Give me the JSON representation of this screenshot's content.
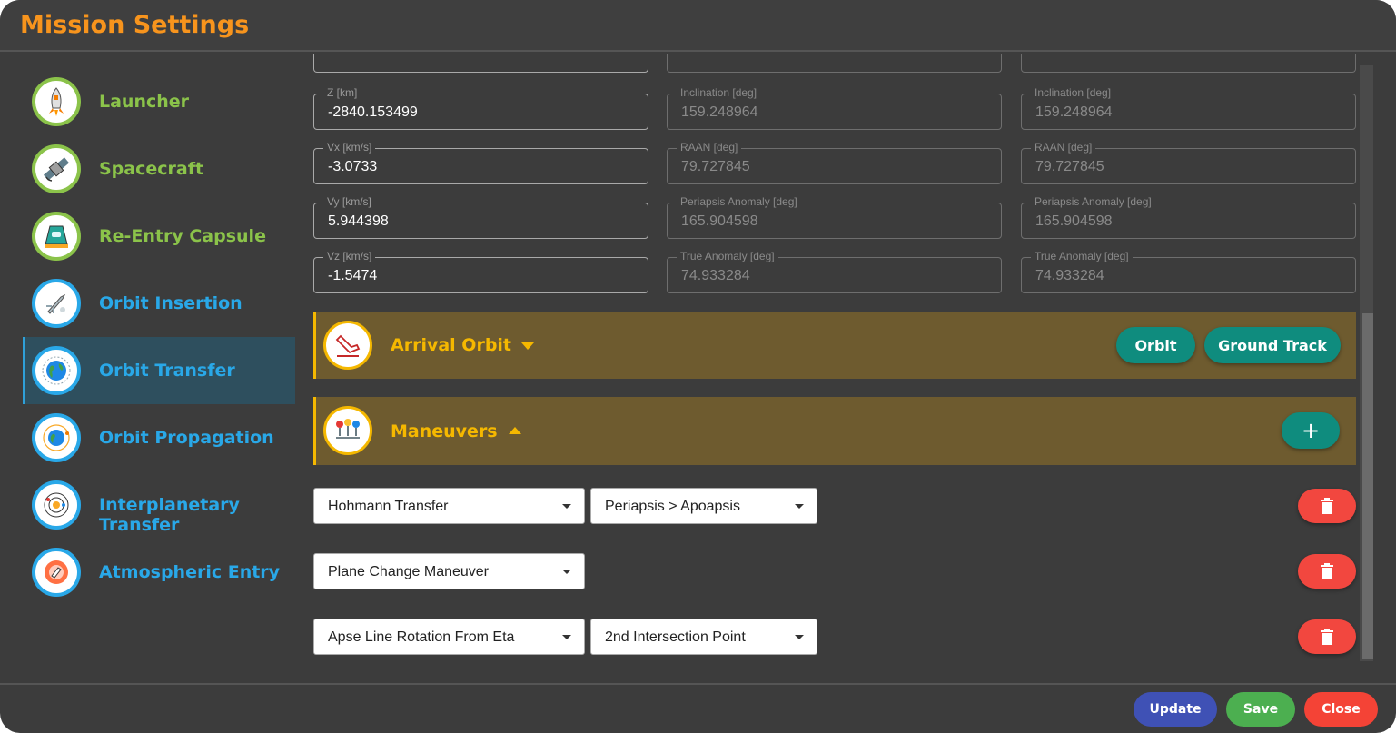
{
  "window": {
    "title": "Mission Settings"
  },
  "sidebar": {
    "items": [
      {
        "label": "Launcher",
        "icon": "rocket-icon",
        "color": "#8bc34a"
      },
      {
        "label": "Spacecraft",
        "icon": "satellite-icon",
        "color": "#8bc34a"
      },
      {
        "label": "Re-Entry Capsule",
        "icon": "capsule-icon",
        "color": "#8bc34a"
      },
      {
        "label": "Orbit Insertion",
        "icon": "orbit-insertion-icon",
        "color": "#29a8e8"
      },
      {
        "label": "Orbit Transfer",
        "icon": "earth-orbit-icon",
        "color": "#29a8e8",
        "active": true
      },
      {
        "label": "Orbit Propagation",
        "icon": "orbit-propagation-icon",
        "color": "#29a8e8"
      },
      {
        "label": "Interplanetary Transfer",
        "icon": "solar-system-icon",
        "color": "#29a8e8"
      },
      {
        "label": "Atmospheric Entry",
        "icon": "atmospheric-entry-icon",
        "color": "#29a8e8"
      }
    ]
  },
  "state_fields": [
    {
      "label": "Z [km]",
      "value": "-2840.153499"
    },
    {
      "label": "Vx [km/s]",
      "value": "-3.0733"
    },
    {
      "label": "Vy [km/s]",
      "value": "5.944398"
    },
    {
      "label": "Vz [km/s]",
      "value": "-1.5474"
    }
  ],
  "elements_a": [
    {
      "label": "Inclination [deg]",
      "value": "159.248964"
    },
    {
      "label": "RAAN [deg]",
      "value": "79.727845"
    },
    {
      "label": "Periapsis Anomaly [deg]",
      "value": "165.904598"
    },
    {
      "label": "True Anomaly [deg]",
      "value": "74.933284"
    }
  ],
  "elements_b": [
    {
      "label": "Inclination [deg]",
      "value": "159.248964"
    },
    {
      "label": "RAAN [deg]",
      "value": "79.727845"
    },
    {
      "label": "Periapsis Anomaly [deg]",
      "value": "165.904598"
    },
    {
      "label": "True Anomaly [deg]",
      "value": "74.933284"
    }
  ],
  "arrival": {
    "title": "Arrival Orbit",
    "icon": "arrival-icon",
    "orbit_label": "Orbit",
    "ground_track_label": "Ground Track"
  },
  "maneuvers": {
    "title": "Maneuvers",
    "icon": "maneuvers-icon",
    "add_label": "+",
    "rows": [
      {
        "type": "Hohmann Transfer",
        "option": "Periapsis > Apoapsis"
      },
      {
        "type": "Plane Change Maneuver"
      },
      {
        "type": "Apse Line Rotation From Eta",
        "option": "2nd Intersection Point"
      }
    ]
  },
  "footer": {
    "update_label": "Update",
    "save_label": "Save",
    "close_label": "Close"
  },
  "colors": {
    "title": "#f7941d",
    "accent_teal": "#0f8c7e",
    "section_bg": "#6e5b2f",
    "section_accent": "#f5b800",
    "delete": "#f2473f",
    "update": "#3f51b5",
    "save": "#4caf50",
    "close": "#f44336"
  }
}
